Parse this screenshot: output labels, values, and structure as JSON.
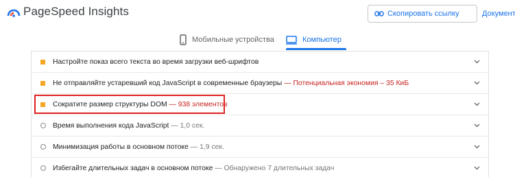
{
  "header": {
    "brand": "PageSpeed Insights",
    "copy_link_label": "Скопировать ссылку",
    "docs_label": "Документация"
  },
  "tabs": [
    {
      "label": "Мобильные устройства",
      "active": false,
      "icon": "phone-icon"
    },
    {
      "label": "Компьютер",
      "active": true,
      "icon": "desktop-icon"
    }
  ],
  "colors": {
    "accent": "#1a73e8",
    "warning": "#f5a623",
    "highlight": "#e02020",
    "savings": "#c5221f"
  },
  "audits": [
    {
      "title": "Настройте показ всего текста во время загрузки веб-шрифтов",
      "detail": "",
      "marker": "warning-square"
    },
    {
      "title": "Не отправляйте устаревший код JavaScript в современные браузеры",
      "detail": " — Потенциальная экономия – 35 КиБ",
      "marker": "warning-square"
    },
    {
      "title": "Сократите размер структуры DOM",
      "detail": " — 938 элементов",
      "marker": "warning-square"
    },
    {
      "title": "Время выполнения кода JavaScript",
      "detail": " — 1,0 сек.",
      "marker": "info-circle"
    },
    {
      "title": "Минимизация работы в основном потоке",
      "detail": " — 1,9 сек.",
      "marker": "info-circle"
    },
    {
      "title": "Избегайте длительных задач в основном потоке",
      "detail": " — Обнаружено 7 длительных задач",
      "marker": "info-circle"
    }
  ]
}
